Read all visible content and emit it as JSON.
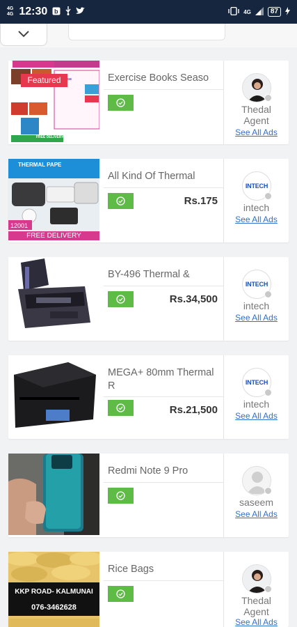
{
  "status_bar": {
    "network": [
      "4G",
      "4G"
    ],
    "time": "12:30",
    "icons": [
      "notification-b-icon",
      "usb-icon",
      "twitter-icon"
    ],
    "right_network": "4G",
    "battery": "87"
  },
  "listings": [
    {
      "title": "Exercise Books Seaso",
      "featured_label": "Featured",
      "price": "",
      "seller": "Thedal Agent",
      "see_all": "See All Ads",
      "thumb_texts": [
        "200 PAGE",
        "FREE DELIVERY"
      ]
    },
    {
      "title": "All Kind Of Thermal",
      "price": "Rs.175",
      "seller": "intech",
      "see_all": "See All Ads",
      "thumb_texts": [
        "THERMAL PAPE",
        "12001",
        "FREE DELIVERY"
      ]
    },
    {
      "title": "BY-496 Thermal &",
      "price": "Rs.34,500",
      "seller": "intech",
      "see_all": "See All Ads"
    },
    {
      "title": "MEGA+ 80mm Thermal R",
      "price": "Rs.21,500",
      "seller": "intech",
      "see_all": "See All Ads"
    },
    {
      "title": "Redmi Note 9 Pro",
      "price": "",
      "seller": "saseem",
      "see_all": "See All Ads"
    },
    {
      "title": "Rice Bags",
      "price": "",
      "seller": "Thedal Agent",
      "see_all": "See All Ads",
      "thumb_texts": [
        "KKP ROAD- KALMUNAI",
        "076-3462628"
      ]
    }
  ],
  "intech_logo_text": "INTECH",
  "colors": {
    "status_bar": "#16263f",
    "badge": "#5dbb46",
    "link": "#2f6fd0",
    "featured": "#e8384f"
  }
}
